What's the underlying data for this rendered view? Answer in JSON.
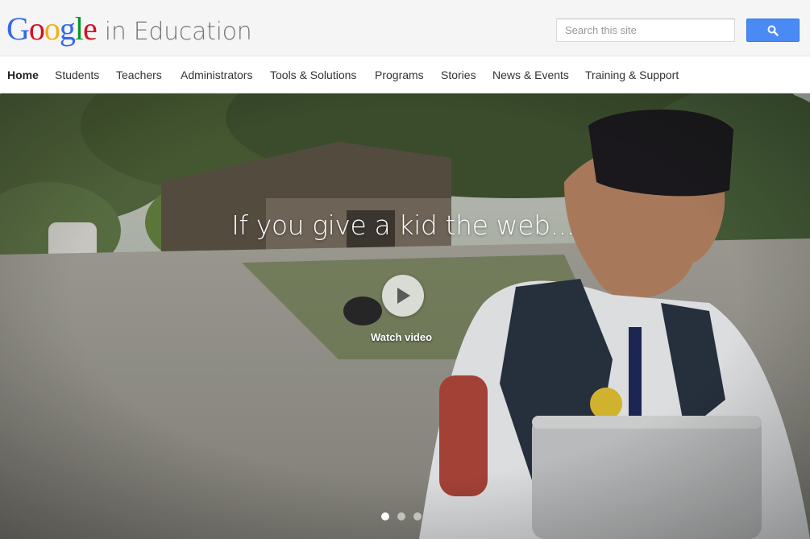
{
  "header": {
    "logo": {
      "letters": [
        {
          "char": "G",
          "color": "#3369e8"
        },
        {
          "char": "o",
          "color": "#d50f25"
        },
        {
          "char": "o",
          "color": "#eeb211"
        },
        {
          "char": "g",
          "color": "#3369e8"
        },
        {
          "char": "l",
          "color": "#009925"
        },
        {
          "char": "e",
          "color": "#d50f25"
        }
      ],
      "subtitle": "in Education"
    },
    "search": {
      "placeholder": "Search this site",
      "button_icon": "search-icon",
      "button_color": "#4a8af4"
    }
  },
  "nav": {
    "items": [
      {
        "label": "Home",
        "active": true
      },
      {
        "label": "Students",
        "active": false
      },
      {
        "label": "Teachers",
        "active": false
      },
      {
        "label": "Administrators",
        "active": false
      },
      {
        "label": "Tools & Solutions",
        "active": false
      },
      {
        "label": "Programs",
        "active": false
      },
      {
        "label": "Stories",
        "active": false
      },
      {
        "label": "News & Events",
        "active": false
      },
      {
        "label": "Training & Support",
        "active": false
      }
    ]
  },
  "hero": {
    "title": "If you give a kid the web...",
    "play_icon": "play-icon",
    "watch_label": "Watch video",
    "carousel": {
      "total": 3,
      "active_index": 0
    }
  }
}
